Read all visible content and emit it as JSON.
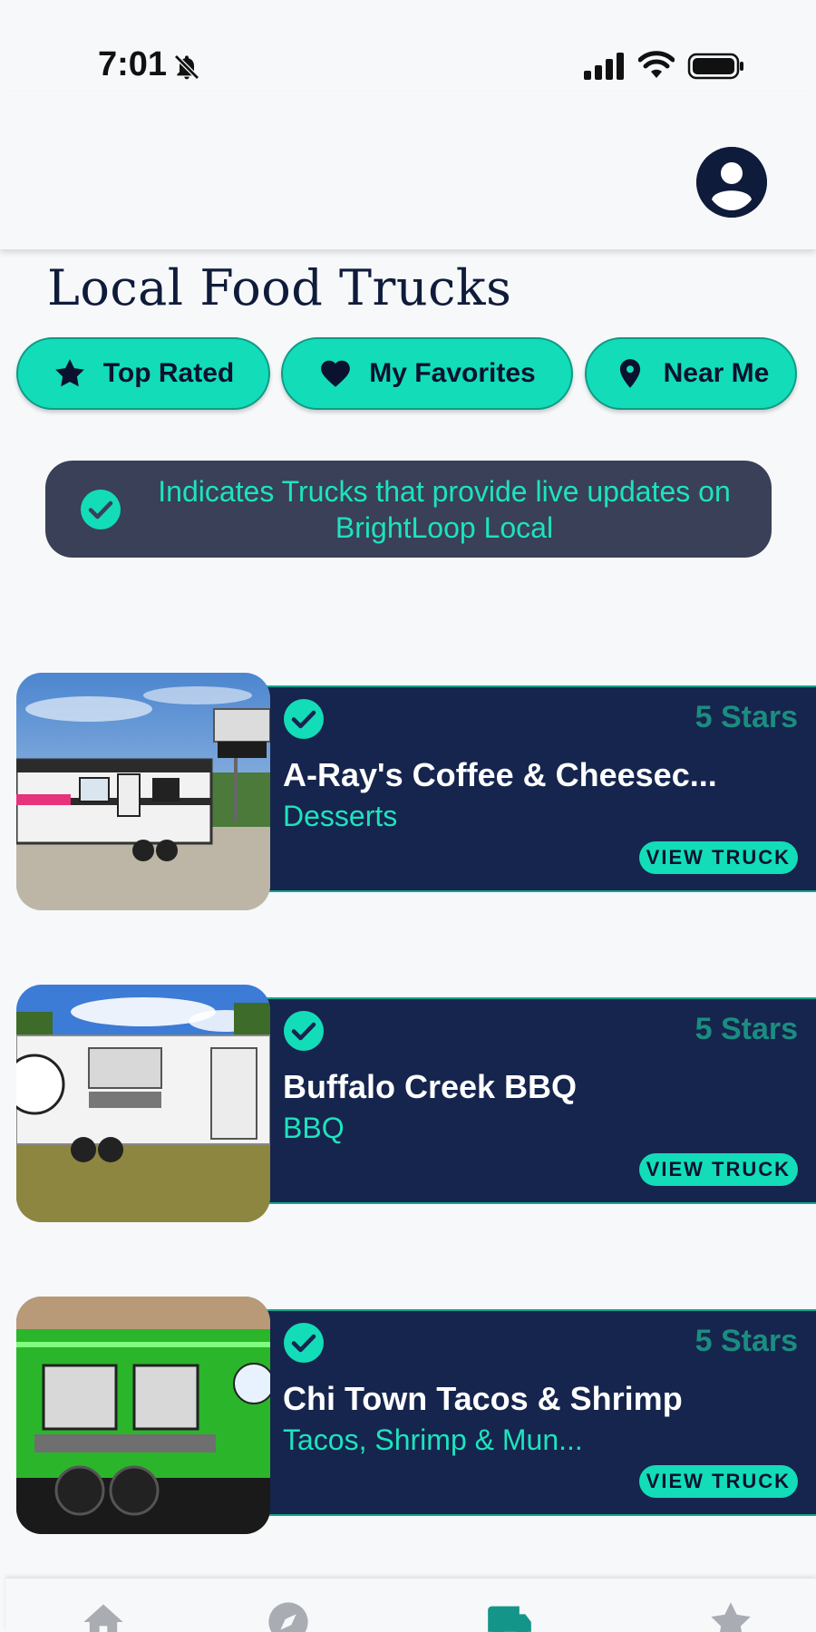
{
  "status_bar": {
    "time": "7:01",
    "icons": [
      "bell-slash-icon",
      "cellular-signal-icon",
      "wifi-icon",
      "battery-icon"
    ]
  },
  "header": {
    "profile_icon": "account-circle-icon"
  },
  "page": {
    "title": "Local Food Trucks"
  },
  "filters": [
    {
      "label": "Top Rated",
      "icon": "star-icon"
    },
    {
      "label": "My Favorites",
      "icon": "heart-icon"
    },
    {
      "label": "Near Me",
      "icon": "location-pin-icon"
    }
  ],
  "info_banner": {
    "icon": "check-circle-icon",
    "text": "Indicates Trucks that provide live updates on BrightLoop Local"
  },
  "trucks": [
    {
      "name": "A-Ray's Coffee & Cheesec...",
      "category": "Desserts",
      "rating": "5 Stars",
      "verified": true,
      "button": "VIEW TRUCK"
    },
    {
      "name": "Buffalo Creek BBQ",
      "category": "BBQ",
      "rating": "5 Stars",
      "verified": true,
      "button": "VIEW TRUCK"
    },
    {
      "name": "Chi Town Tacos & Shrimp",
      "category": "Tacos, Shrimp & Mun...",
      "rating": "5 Stars",
      "verified": true,
      "button": "VIEW TRUCK"
    }
  ],
  "tab_bar": {
    "tabs": [
      {
        "icon": "home-icon",
        "active": false
      },
      {
        "icon": "compass-icon",
        "active": false
      },
      {
        "icon": "truck-icon",
        "active": true
      },
      {
        "icon": "star-icon",
        "active": false
      }
    ]
  },
  "colors": {
    "accent": "#13dcb9",
    "navy": "#16254d",
    "banner": "#394058",
    "rating": "#1b8d80",
    "background": "#f6f8fa"
  }
}
